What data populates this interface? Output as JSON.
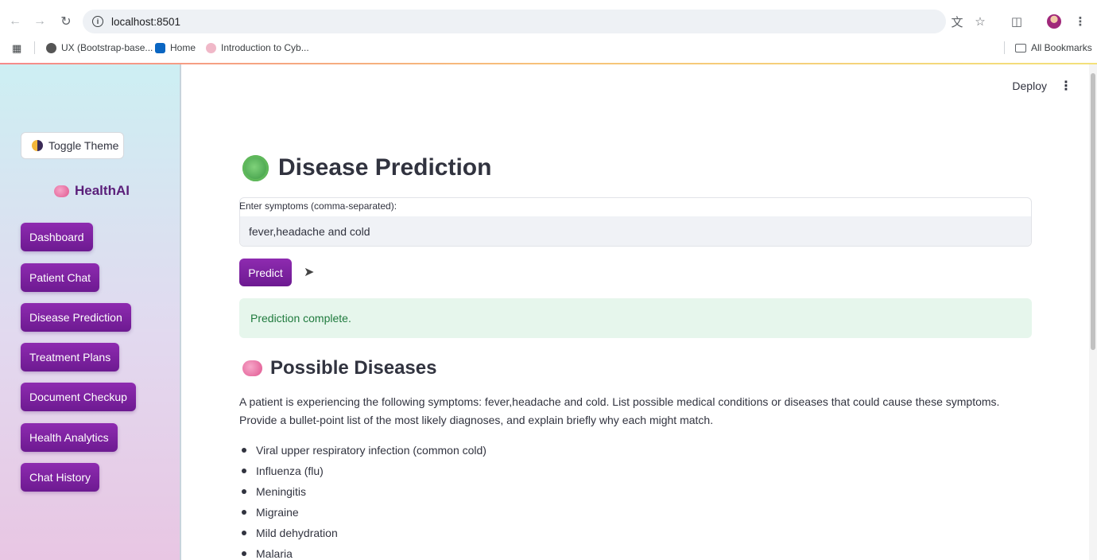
{
  "browser": {
    "url": "localhost:8501",
    "bookmarks": [
      {
        "label": "UX (Bootstrap-base...",
        "color": "#555555"
      },
      {
        "label": "Home",
        "color": "#0a66c2"
      },
      {
        "label": "Introduction to Cyb...",
        "color": "#e07b9a"
      }
    ],
    "all_bookmarks": "All Bookmarks"
  },
  "sidebar": {
    "toggle_label": "Toggle Theme",
    "brand": "HealthAI",
    "items": [
      {
        "label": "Dashboard"
      },
      {
        "label": "Patient Chat"
      },
      {
        "label": "Disease Prediction"
      },
      {
        "label": "Treatment Plans"
      },
      {
        "label": "Document Checkup"
      },
      {
        "label": "Health Analytics"
      },
      {
        "label": "Chat History"
      }
    ]
  },
  "header": {
    "deploy": "Deploy"
  },
  "main": {
    "title": "Disease Prediction",
    "input_label": "Enter symptoms (comma-separated):",
    "input_value": "fever,headache and cold",
    "predict_label": "Predict",
    "status": "Prediction complete.",
    "section_title": "Possible Diseases",
    "prompt": "A patient is experiencing the following symptoms: fever,headache and cold. List possible medical conditions or diseases that could cause these symptoms. Provide a bullet-point list of the most likely diagnoses, and explain briefly why each might match.",
    "diseases": [
      "Viral upper respiratory infection (common cold)",
      "Influenza (flu)",
      "Meningitis",
      "Migraine",
      "Mild dehydration",
      "Malaria"
    ]
  },
  "colors": {
    "accent": "#7b1fa2",
    "success_bg": "#e6f6ec",
    "success_text": "#1f7a3d"
  }
}
